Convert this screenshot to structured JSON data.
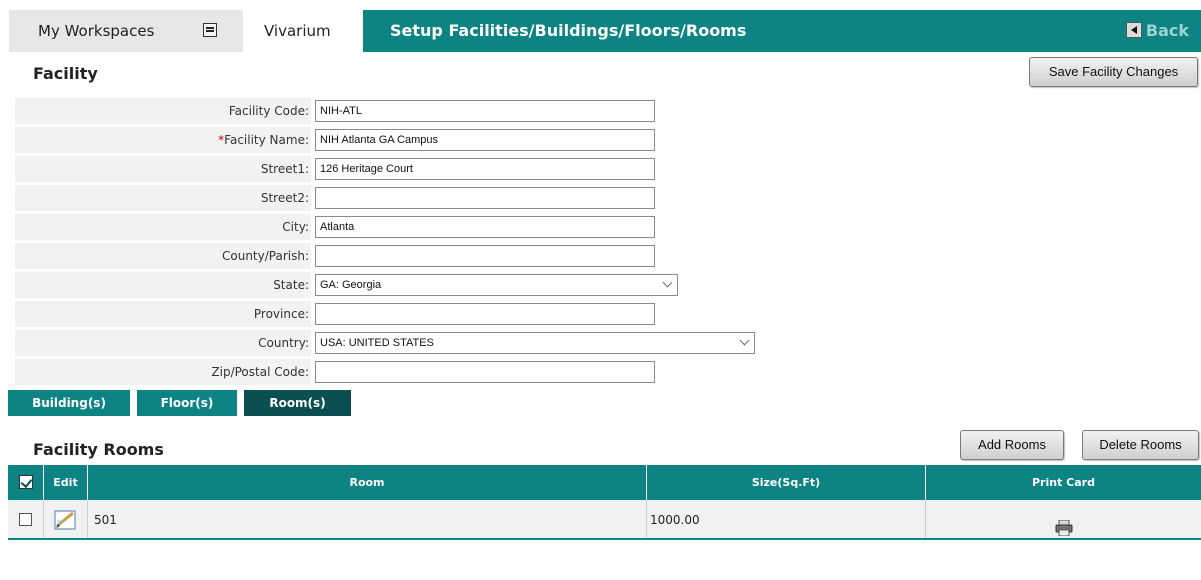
{
  "header": {
    "workspaces_label": "My Workspaces",
    "vivarium_label": "Vivarium",
    "page_title": "Setup Facilities/Buildings/Floors/Rooms",
    "back_label": "Back"
  },
  "facility": {
    "section_title": "Facility",
    "save_label": "Save Facility Changes",
    "fields": [
      {
        "label": "Facility Code:",
        "value": "NIH-ATL"
      },
      {
        "label": "Facility Name:",
        "value": "NIH Atlanta GA Campus",
        "required": "*"
      },
      {
        "label": "Street1:",
        "value": "126 Heritage Court"
      },
      {
        "label": "Street2:",
        "value": ""
      },
      {
        "label": "City:",
        "value": "Atlanta"
      },
      {
        "label": "County/Parish:",
        "value": ""
      },
      {
        "label": "State:",
        "value": "GA: Georgia"
      },
      {
        "label": "Province:",
        "value": ""
      },
      {
        "label": "Country:",
        "value": "USA: UNITED STATES"
      },
      {
        "label": "Zip/Postal Code:",
        "value": ""
      }
    ]
  },
  "subtabs": [
    {
      "label": "Building(s)"
    },
    {
      "label": "Floor(s)"
    },
    {
      "label": "Room(s)"
    }
  ],
  "rooms": {
    "section_title": "Facility Rooms",
    "add_label": "Add Rooms",
    "delete_label": "Delete Rooms",
    "columns": {
      "edit": "Edit",
      "room": "Room",
      "size": "Size(Sq.Ft)",
      "print": "Print Card"
    },
    "rows": [
      {
        "room": "501",
        "size": "1000.00"
      }
    ]
  },
  "colors": {
    "teal": "#0d8483",
    "dark_teal": "#0b4f51"
  },
  "icons": [
    "chevron-dropdown-icon",
    "back-arrow-icon",
    "select-all-icon",
    "edit-pencil-icon",
    "print-card-icon"
  ]
}
